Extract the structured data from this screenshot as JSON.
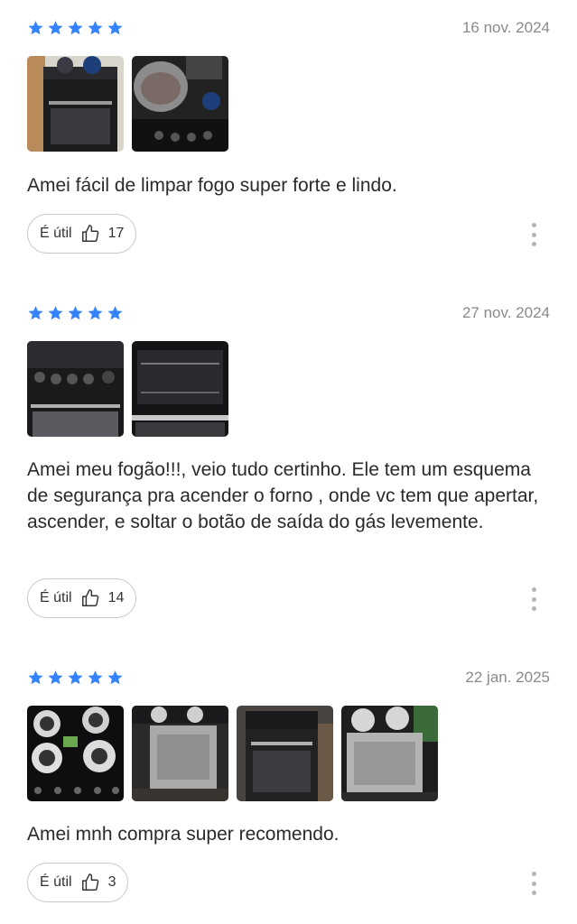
{
  "colors": {
    "star": "#3483fa",
    "date": "#8a8a8a",
    "text": "#2a2a2a",
    "border": "#c8c8c8"
  },
  "reviews": [
    {
      "rating": 5,
      "date": "16 nov. 2024",
      "photos": [
        "stove-front-photo",
        "stove-top-pot-photo"
      ],
      "text": "Amei fácil de limpar fogo super forte e lindo.",
      "useful_label": "É útil",
      "useful_count": "17"
    },
    {
      "rating": 5,
      "date": "27 nov. 2024",
      "photos": [
        "stove-knobs-photo",
        "oven-interior-photo"
      ],
      "text": "Amei meu fogão!!!, veio tudo certinho. Ele tem um esquema de segurança pra acender o forno , onde vc tem que apertar, ascender, e soltar o botão de saída do gás levemente.",
      "useful_label": "É útil",
      "useful_count": "14"
    },
    {
      "rating": 5,
      "date": "22 jan. 2025",
      "photos": [
        "burners-top-photo",
        "stove-side-photo",
        "stove-front-oven-photo",
        "stove-side-burners-photo"
      ],
      "text": "Amei mnh compra super recomendo.",
      "useful_label": "É útil",
      "useful_count": "3"
    }
  ]
}
